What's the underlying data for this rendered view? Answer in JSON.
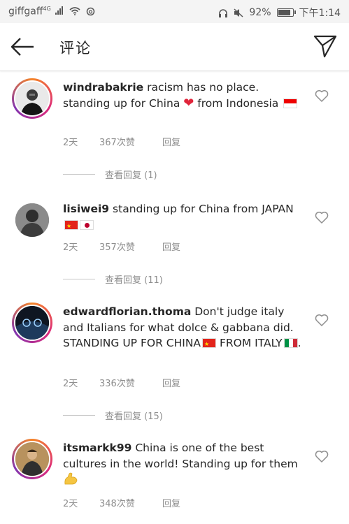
{
  "status_bar": {
    "carrier": "giffgaff",
    "network": "4G",
    "battery": "92%",
    "time": "下午1:14"
  },
  "header": {
    "title": "评论"
  },
  "comments": [
    {
      "username": "windrabakrie",
      "text_before": "racism has no place. standing up for China",
      "text_after": "from Indonesia",
      "time": "2天",
      "likes": "367次赞",
      "reply": "回复",
      "view_replies": "查看回复 (1)"
    },
    {
      "username": "lisiwei9",
      "text_before": "standing up for China from JAPAN",
      "text_after": "",
      "time": "2天",
      "likes": "357次赞",
      "reply": "回复",
      "view_replies": "查看回复 (11)"
    },
    {
      "username": "edwardflorian.thoma",
      "text_before": "Don't judge italy and Italians for what dolce & gabbana did. STANDING UP FOR CHINA",
      "text_mid": "FROM ITALY",
      "text_after": ".",
      "time": "2天",
      "likes": "336次赞",
      "reply": "回复",
      "view_replies": "查看回复 (15)"
    },
    {
      "username": "itsmarkk99",
      "text_before": "China is one of the best cultures in the world! Standing up for them",
      "text_after": "",
      "time": "2天",
      "likes": "348次赞",
      "reply": "回复"
    }
  ]
}
